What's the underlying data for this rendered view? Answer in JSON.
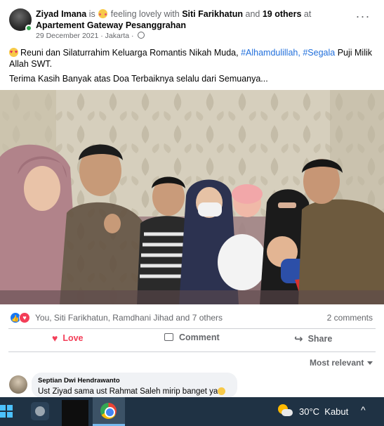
{
  "post": {
    "author": "Ziyad Imana",
    "is_word": "is",
    "feeling_text": "feeling lovely with",
    "tagged": "Siti Farikhatun",
    "and_word": "and",
    "others": "19 others",
    "at_word": "at",
    "place": "Apartement Gateway Pesanggrahan",
    "date": "29 December 2021",
    "separator": "·",
    "location": "Jakarta",
    "separator2": "·",
    "text_line1_pre": "Reuni dan Silaturrahim Keluarga Romantis Nikah Muda,",
    "hashtag1": "#Alhamdulillah,",
    "hashtag2": "#Segala",
    "text_line1_post": "Puji Milik Allah SWT.",
    "text_line2": "Terima Kasih Banyak atas Doa Terbaiknya selalu dari Semuanya..."
  },
  "reactions": {
    "names": "You, Siti Farikhatun, Ramdhani Jihad and 7 others",
    "comments_count": "2 comments"
  },
  "actions": {
    "love": "Love",
    "comment": "Comment",
    "share": "Share"
  },
  "sort": {
    "label": "Most relevant"
  },
  "comment": {
    "author": "Septian Dwi Hendrawanto",
    "text": "Ust Ziyad sama ust Rahmat Saleh mirip banget ya"
  },
  "taskbar": {
    "weather_temp": "30°C",
    "weather_desc": "Kabut"
  },
  "colors": {
    "link": "#216fdb",
    "love": "#f33e58",
    "like": "#1877f2",
    "taskbar": "#1f3244"
  },
  "icons": [
    "more-icon",
    "globe-icon",
    "like-reaction-icon",
    "love-reaction-icon",
    "heart-icon",
    "comment-icon",
    "share-icon",
    "chevron-down-icon",
    "windows-start-icon",
    "chrome-icon",
    "weather-icon"
  ]
}
